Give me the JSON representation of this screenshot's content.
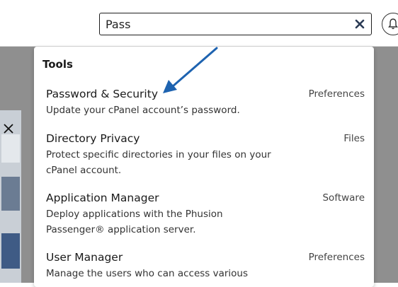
{
  "search": {
    "value": "Pass",
    "clear_icon": "close-icon"
  },
  "header": {
    "notification_icon": "bell-icon"
  },
  "dropdown": {
    "section_title": "Tools",
    "results": [
      {
        "title": "Password & Security",
        "description": "Update your cPanel account’s password.",
        "category": "Preferences"
      },
      {
        "title": "Directory Privacy",
        "description": "Protect specific directories in your files on your cPanel account.",
        "category": "Files"
      },
      {
        "title": "Application Manager",
        "description": "Deploy applications with the Phusion Passenger® application server.",
        "category": "Software"
      },
      {
        "title": "User Manager",
        "description": "Manage the users who can access various",
        "category": "Preferences"
      }
    ]
  },
  "colors": {
    "arrow": "#1e63b0",
    "overlay": "#8f8f8f"
  }
}
